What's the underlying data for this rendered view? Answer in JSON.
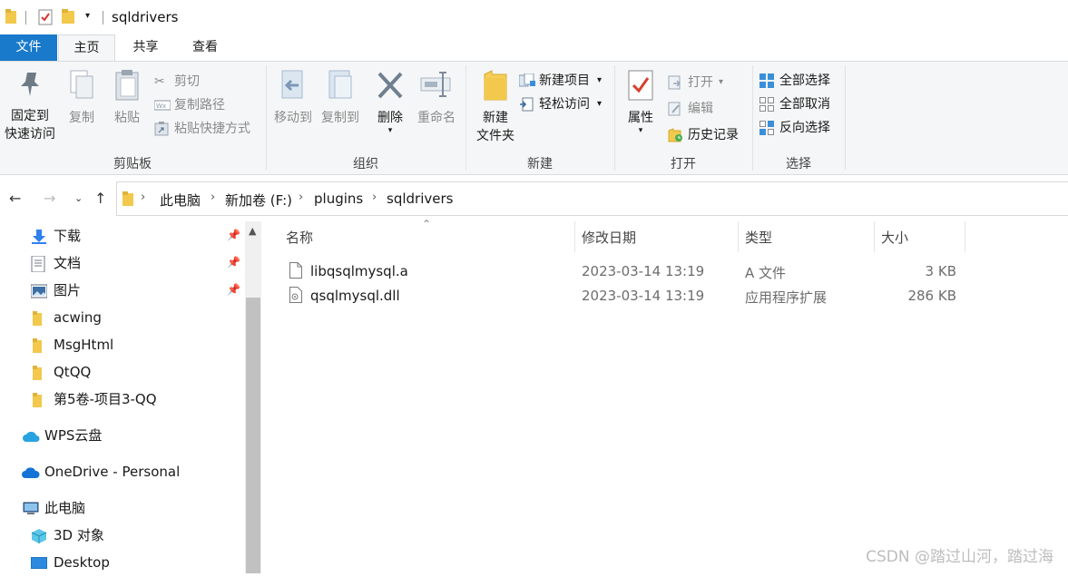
{
  "window": {
    "title": "sqldrivers"
  },
  "ribbon_tabs": [
    {
      "label": "文件"
    },
    {
      "label": "主页"
    },
    {
      "label": "共享"
    },
    {
      "label": "查看"
    }
  ],
  "ribbon": {
    "clipboard": {
      "label": "剪贴板",
      "pin_line1": "固定到",
      "pin_line2": "快速访问",
      "copy": "复制",
      "paste": "粘贴",
      "cut": "剪切",
      "copy_path": "复制路径",
      "paste_shortcut": "粘贴快捷方式"
    },
    "organize": {
      "label": "组织",
      "move_to": "移动到",
      "copy_to": "复制到",
      "delete": "删除",
      "rename": "重命名"
    },
    "new": {
      "label": "新建",
      "new_folder_line1": "新建",
      "new_folder_line2": "文件夹",
      "new_item": "新建项目",
      "easy_access": "轻松访问"
    },
    "open": {
      "label": "打开",
      "properties": "属性",
      "open": "打开",
      "edit": "编辑",
      "history": "历史记录"
    },
    "select": {
      "label": "选择",
      "select_all": "全部选择",
      "select_none": "全部取消",
      "invert": "反向选择"
    }
  },
  "breadcrumb": [
    "此电脑",
    "新加卷 (F:)",
    "plugins",
    "sqldrivers"
  ],
  "nav_pane": {
    "quick_access": [
      {
        "label": "下载",
        "pinned": true
      },
      {
        "label": "文档",
        "pinned": true
      },
      {
        "label": "图片",
        "pinned": true
      },
      {
        "label": "acwing"
      },
      {
        "label": "MsgHtml"
      },
      {
        "label": "QtQQ"
      },
      {
        "label": "第5卷-项目3-QQ"
      }
    ],
    "wps": "WPS云盘",
    "onedrive": "OneDrive - Personal",
    "this_pc": "此电脑",
    "pc_items": [
      {
        "label": "3D 对象"
      },
      {
        "label": "Desktop"
      }
    ]
  },
  "columns": [
    "名称",
    "修改日期",
    "类型",
    "大小"
  ],
  "files": [
    {
      "name": "libqsqlmysql.a",
      "date": "2023-03-14 13:19",
      "type": "A 文件",
      "size": "3 KB",
      "icon": "generic-file-icon"
    },
    {
      "name": "qsqlmysql.dll",
      "date": "2023-03-14 13:19",
      "type": "应用程序扩展",
      "size": "286 KB",
      "icon": "dll-file-icon"
    }
  ],
  "watermark": "CSDN @踏过山河，踏过海",
  "colors": {
    "accent": "#1979ca",
    "folder": "#f2c94c",
    "ribbon_bg": "#f5f6f7"
  }
}
